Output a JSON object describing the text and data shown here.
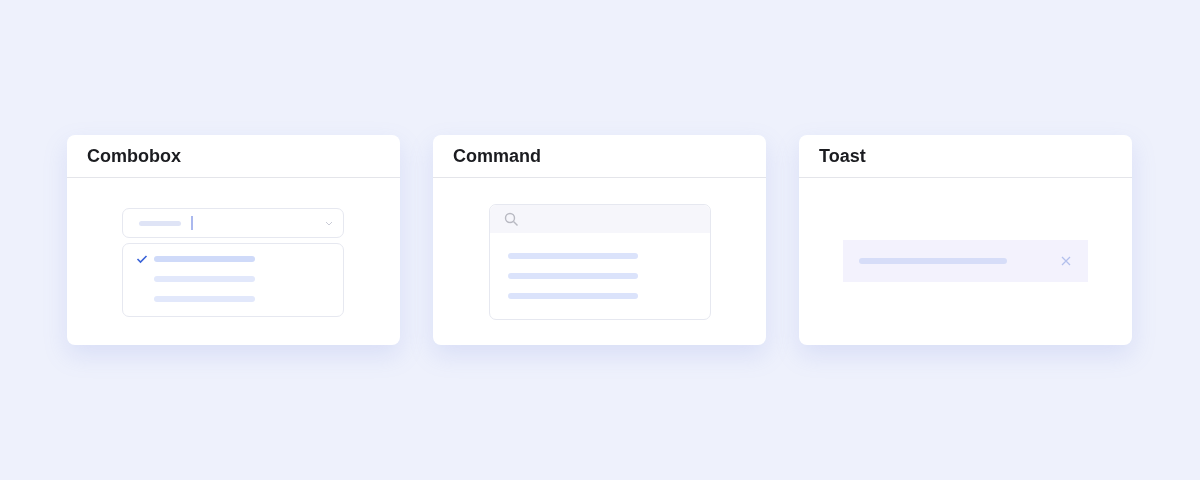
{
  "cards": [
    {
      "title": "Combobox",
      "kind": "combobox",
      "options": [
        {
          "selected": true
        },
        {
          "selected": false
        },
        {
          "selected": false
        }
      ]
    },
    {
      "title": "Command",
      "kind": "command",
      "items": [
        {
          "kind": "placeholder"
        },
        {
          "kind": "placeholder"
        },
        {
          "kind": "placeholder"
        }
      ]
    },
    {
      "title": "Toast",
      "kind": "toast",
      "dismissible": true
    }
  ]
}
